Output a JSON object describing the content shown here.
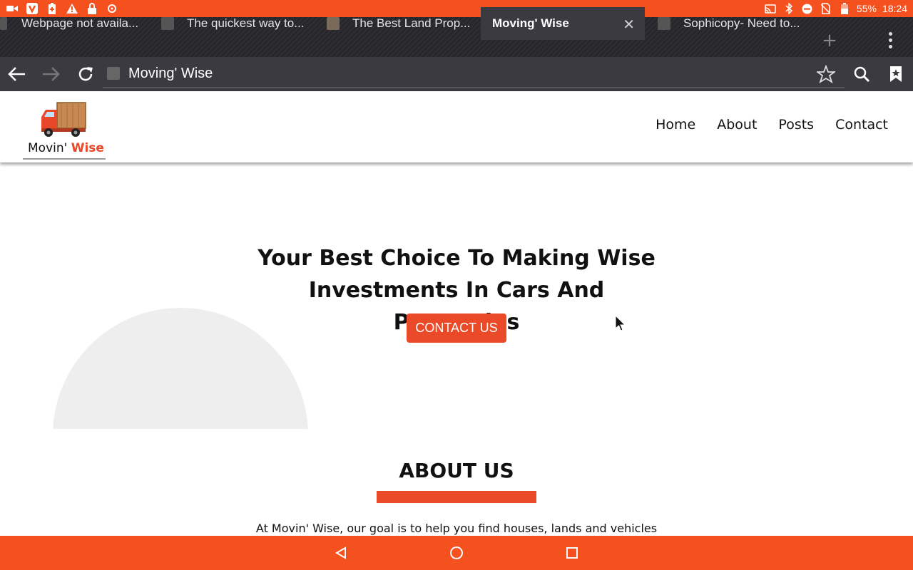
{
  "status_bar": {
    "battery": "55%",
    "time": "18:24",
    "left_icons": [
      "video-icon",
      "vivaldi-icon",
      "battery-plus-icon",
      "warning-icon",
      "lock-icon",
      "settings-icon"
    ],
    "right_icons": [
      "cast-icon",
      "bluetooth-icon",
      "do-not-disturb-icon",
      "no-sim-icon",
      "battery-icon"
    ]
  },
  "tabs": [
    {
      "title": "Webpage not availa...",
      "active": false
    },
    {
      "title": "The quickest way to...",
      "active": false
    },
    {
      "title": "The Best Land Prop...",
      "active": false
    },
    {
      "title": "Moving' Wise",
      "active": true
    },
    {
      "title": "Sophicopy- Need to...",
      "active": false
    }
  ],
  "toolbar": {
    "address_title": "Moving' Wise",
    "icons": [
      "back-arrow-icon",
      "forward-arrow-icon",
      "reload-icon",
      "star-icon",
      "search-icon",
      "bookmark-icon"
    ]
  },
  "site": {
    "logo_text_main": "Movin'",
    "logo_text_accent": "Wise",
    "nav": [
      "Home",
      "About",
      "Posts",
      "Contact"
    ],
    "hero_title_line1": "Your Best Choice To Making Wise",
    "hero_title_line2": "Investments In Cars And Properties",
    "cta_label": "CONTACT US",
    "about_heading": "ABOUT US",
    "about_text": "At Movin' Wise, our goal is to help you find houses, lands and vehicles"
  },
  "colors": {
    "accent": "#f4511e",
    "brand_red": "#ea4a28",
    "tab_bar": "#26262b",
    "toolbar": "#3a3a40"
  },
  "system_nav": [
    "back-triangle-icon",
    "home-circle-icon",
    "recents-square-icon"
  ]
}
